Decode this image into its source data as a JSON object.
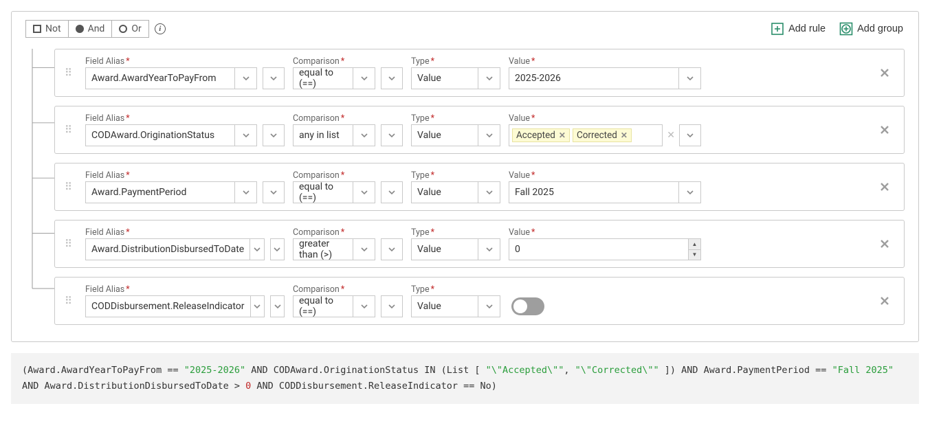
{
  "header": {
    "not_label": "Not",
    "and_label": "And",
    "or_label": "Or",
    "add_rule_label": "Add rule",
    "add_group_label": "Add group"
  },
  "labels": {
    "field_alias": "Field Alias",
    "comparison": "Comparison",
    "type": "Type",
    "value": "Value"
  },
  "rules": [
    {
      "field": "Award.AwardYearToPayFrom",
      "comparison": "equal to (==)",
      "type": "Value",
      "value_kind": "text",
      "value": "2025-2026"
    },
    {
      "field": "CODAward.OriginationStatus",
      "comparison": "any in list",
      "type": "Value",
      "value_kind": "tags",
      "tags": [
        "Accepted",
        "Corrected"
      ]
    },
    {
      "field": "Award.PaymentPeriod",
      "comparison": "equal to (==)",
      "type": "Value",
      "value_kind": "text",
      "value": "Fall 2025"
    },
    {
      "field": "Award.DistributionDisbursedToDate",
      "comparison": "greater than (>)",
      "type": "Value",
      "value_kind": "number",
      "value": "0"
    },
    {
      "field": "CODDisbursement.ReleaseIndicator",
      "comparison": "equal to (==)",
      "type": "Value",
      "value_kind": "toggle",
      "toggle_on": false
    }
  ],
  "expression": {
    "plain": "(Award.AwardYearToPayFrom == \"2025-2026\" AND CODAward.OriginationStatus IN (List [ \"\\\"Accepted\\\"\", \"\\\"Corrected\\\"\" ]) AND Award.PaymentPeriod == \"Fall 2025\" AND Award.DistributionDisbursedToDate > 0 AND CODDisbursement.ReleaseIndicator == No)"
  }
}
